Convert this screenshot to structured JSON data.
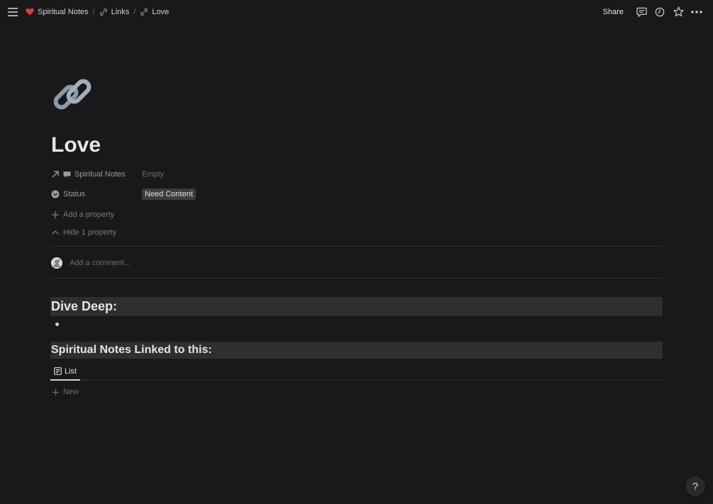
{
  "breadcrumb": [
    {
      "label": "Spiritual Notes",
      "icon": "heart-icon"
    },
    {
      "label": "Links",
      "icon": "link-icon"
    },
    {
      "label": "Love",
      "icon": "link-icon"
    }
  ],
  "breadcrumb_separator": "/",
  "topbar": {
    "share_label": "Share",
    "icons": [
      "comment-icon",
      "clock-icon",
      "star-icon",
      "more-icon"
    ]
  },
  "page": {
    "icon": "link-emoji-icon",
    "title": "Love"
  },
  "properties": [
    {
      "name": "Spiritual Notes",
      "type_icon": "relation-arrow-icon",
      "value": "Empty"
    },
    {
      "name": "Status",
      "type_icon": "status-icon",
      "value": "Need Content"
    }
  ],
  "actions": {
    "add_property": "Add a property",
    "hide_property": "Hide 1 property"
  },
  "comment": {
    "placeholder": "Add a comment..."
  },
  "blocks": {
    "heading1": "Dive Deep:",
    "heading2": "Spiritual Notes Linked to this:"
  },
  "view": {
    "tab_label": "List",
    "new_label": "New"
  },
  "help_label": "?",
  "colors": {
    "background": "#191919",
    "heading_block_bg": "#2f2f2f",
    "heart": "#e03e3e",
    "tag_bg": "#3d3d3d"
  }
}
